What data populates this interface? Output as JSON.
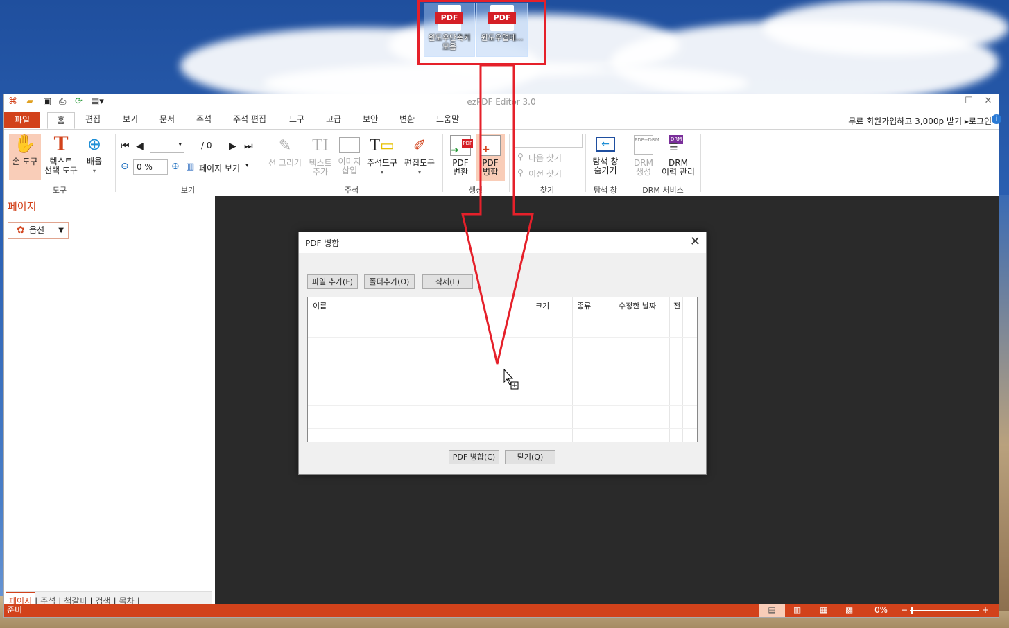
{
  "desktop": {
    "icons": [
      {
        "badge": "PDF",
        "label": "윈도우단축키 모음"
      },
      {
        "badge": "PDF",
        "label": "윈도우업데..."
      }
    ]
  },
  "app": {
    "title": "ezPDF Editor 3.0",
    "tabs": [
      "파일",
      "홈",
      "편집",
      "보기",
      "문서",
      "주석",
      "주석 편집",
      "도구",
      "고급",
      "보안",
      "변환",
      "도움말"
    ],
    "signup": "무료 회원가입하고 3,000p 받기 ▸로그인",
    "ribbon": {
      "hand_tool": "손 도구",
      "text_select": [
        "텍스트",
        "선택 도구"
      ],
      "zoom_btn": "배율",
      "group_tool": "도구",
      "page_total": "/ 0",
      "zoom_value": "0 %",
      "page_view": "페이지 보기",
      "group_view": "보기",
      "draw_line": "선 그리기",
      "add_text": [
        "텍스트",
        "추가"
      ],
      "insert_image": [
        "이미지",
        "삽입"
      ],
      "annot_tool": "주석도구",
      "edit_tool": "편집도구",
      "group_annot": "주석",
      "pdf_convert": [
        "PDF",
        "변환"
      ],
      "pdf_merge": [
        "PDF",
        "병합"
      ],
      "group_create": "생성",
      "find_next": "다음 찾기",
      "find_prev": "이전 찾기",
      "group_find": "찾기",
      "nav_hide": [
        "탐색 창",
        "숨기기"
      ],
      "group_nav": "탐색 창",
      "drm_create": [
        "DRM",
        "생성"
      ],
      "drm_history": [
        "DRM",
        "이력 관리"
      ],
      "group_drm": "DRM 서비스"
    },
    "left_pane": {
      "title": "페이지",
      "options": "옵션",
      "bottom_tabs": [
        "페이지",
        "주석",
        "책갈피",
        "검색",
        "목차"
      ]
    },
    "status": {
      "text": "준비",
      "zoom": "0%"
    }
  },
  "dialog": {
    "title": "PDF 병합",
    "buttons": {
      "add_file": "파일 추가(F)",
      "add_folder": "폴더추가(O)",
      "delete": "삭제(L)",
      "merge": "PDF 병합(C)",
      "close": "닫기(Q)"
    },
    "columns": [
      "이름",
      "크기",
      "종류",
      "수정한 날짜",
      "전"
    ]
  },
  "colors": {
    "accent": "#d2421b",
    "highlight_red": "#e5202a"
  }
}
